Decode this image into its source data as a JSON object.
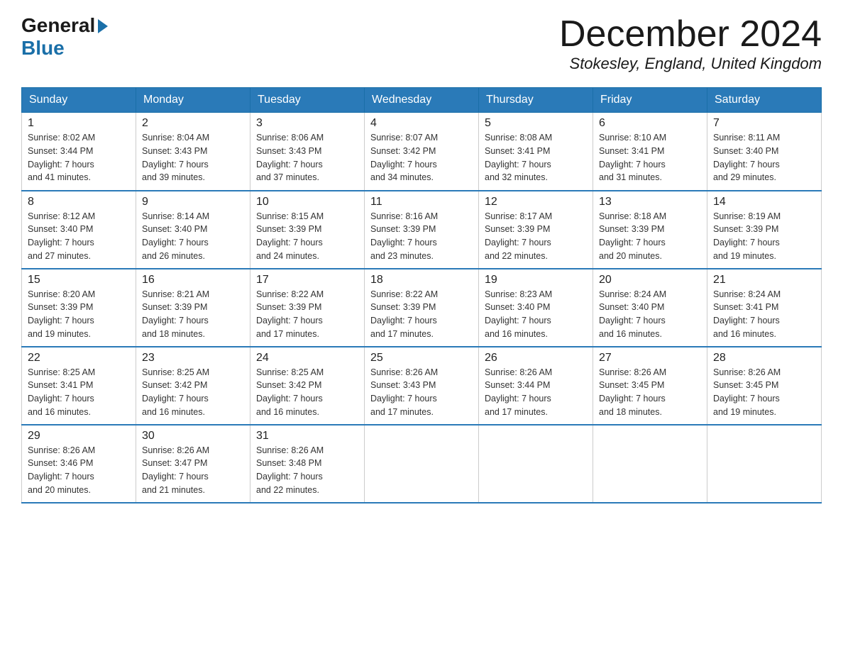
{
  "header": {
    "logo_general": "General",
    "logo_blue": "Blue",
    "month_title": "December 2024",
    "location": "Stokesley, England, United Kingdom"
  },
  "days_of_week": [
    "Sunday",
    "Monday",
    "Tuesday",
    "Wednesday",
    "Thursday",
    "Friday",
    "Saturday"
  ],
  "weeks": [
    [
      {
        "day": "1",
        "sunrise": "8:02 AM",
        "sunset": "3:44 PM",
        "daylight": "7 hours and 41 minutes."
      },
      {
        "day": "2",
        "sunrise": "8:04 AM",
        "sunset": "3:43 PM",
        "daylight": "7 hours and 39 minutes."
      },
      {
        "day": "3",
        "sunrise": "8:06 AM",
        "sunset": "3:43 PM",
        "daylight": "7 hours and 37 minutes."
      },
      {
        "day": "4",
        "sunrise": "8:07 AM",
        "sunset": "3:42 PM",
        "daylight": "7 hours and 34 minutes."
      },
      {
        "day": "5",
        "sunrise": "8:08 AM",
        "sunset": "3:41 PM",
        "daylight": "7 hours and 32 minutes."
      },
      {
        "day": "6",
        "sunrise": "8:10 AM",
        "sunset": "3:41 PM",
        "daylight": "7 hours and 31 minutes."
      },
      {
        "day": "7",
        "sunrise": "8:11 AM",
        "sunset": "3:40 PM",
        "daylight": "7 hours and 29 minutes."
      }
    ],
    [
      {
        "day": "8",
        "sunrise": "8:12 AM",
        "sunset": "3:40 PM",
        "daylight": "7 hours and 27 minutes."
      },
      {
        "day": "9",
        "sunrise": "8:14 AM",
        "sunset": "3:40 PM",
        "daylight": "7 hours and 26 minutes."
      },
      {
        "day": "10",
        "sunrise": "8:15 AM",
        "sunset": "3:39 PM",
        "daylight": "7 hours and 24 minutes."
      },
      {
        "day": "11",
        "sunrise": "8:16 AM",
        "sunset": "3:39 PM",
        "daylight": "7 hours and 23 minutes."
      },
      {
        "day": "12",
        "sunrise": "8:17 AM",
        "sunset": "3:39 PM",
        "daylight": "7 hours and 22 minutes."
      },
      {
        "day": "13",
        "sunrise": "8:18 AM",
        "sunset": "3:39 PM",
        "daylight": "7 hours and 20 minutes."
      },
      {
        "day": "14",
        "sunrise": "8:19 AM",
        "sunset": "3:39 PM",
        "daylight": "7 hours and 19 minutes."
      }
    ],
    [
      {
        "day": "15",
        "sunrise": "8:20 AM",
        "sunset": "3:39 PM",
        "daylight": "7 hours and 19 minutes."
      },
      {
        "day": "16",
        "sunrise": "8:21 AM",
        "sunset": "3:39 PM",
        "daylight": "7 hours and 18 minutes."
      },
      {
        "day": "17",
        "sunrise": "8:22 AM",
        "sunset": "3:39 PM",
        "daylight": "7 hours and 17 minutes."
      },
      {
        "day": "18",
        "sunrise": "8:22 AM",
        "sunset": "3:39 PM",
        "daylight": "7 hours and 17 minutes."
      },
      {
        "day": "19",
        "sunrise": "8:23 AM",
        "sunset": "3:40 PM",
        "daylight": "7 hours and 16 minutes."
      },
      {
        "day": "20",
        "sunrise": "8:24 AM",
        "sunset": "3:40 PM",
        "daylight": "7 hours and 16 minutes."
      },
      {
        "day": "21",
        "sunrise": "8:24 AM",
        "sunset": "3:41 PM",
        "daylight": "7 hours and 16 minutes."
      }
    ],
    [
      {
        "day": "22",
        "sunrise": "8:25 AM",
        "sunset": "3:41 PM",
        "daylight": "7 hours and 16 minutes."
      },
      {
        "day": "23",
        "sunrise": "8:25 AM",
        "sunset": "3:42 PM",
        "daylight": "7 hours and 16 minutes."
      },
      {
        "day": "24",
        "sunrise": "8:25 AM",
        "sunset": "3:42 PM",
        "daylight": "7 hours and 16 minutes."
      },
      {
        "day": "25",
        "sunrise": "8:26 AM",
        "sunset": "3:43 PM",
        "daylight": "7 hours and 17 minutes."
      },
      {
        "day": "26",
        "sunrise": "8:26 AM",
        "sunset": "3:44 PM",
        "daylight": "7 hours and 17 minutes."
      },
      {
        "day": "27",
        "sunrise": "8:26 AM",
        "sunset": "3:45 PM",
        "daylight": "7 hours and 18 minutes."
      },
      {
        "day": "28",
        "sunrise": "8:26 AM",
        "sunset": "3:45 PM",
        "daylight": "7 hours and 19 minutes."
      }
    ],
    [
      {
        "day": "29",
        "sunrise": "8:26 AM",
        "sunset": "3:46 PM",
        "daylight": "7 hours and 20 minutes."
      },
      {
        "day": "30",
        "sunrise": "8:26 AM",
        "sunset": "3:47 PM",
        "daylight": "7 hours and 21 minutes."
      },
      {
        "day": "31",
        "sunrise": "8:26 AM",
        "sunset": "3:48 PM",
        "daylight": "7 hours and 22 minutes."
      },
      {
        "day": "",
        "sunrise": "",
        "sunset": "",
        "daylight": ""
      },
      {
        "day": "",
        "sunrise": "",
        "sunset": "",
        "daylight": ""
      },
      {
        "day": "",
        "sunrise": "",
        "sunset": "",
        "daylight": ""
      },
      {
        "day": "",
        "sunrise": "",
        "sunset": "",
        "daylight": ""
      }
    ]
  ],
  "labels": {
    "sunrise_prefix": "Sunrise: ",
    "sunset_prefix": "Sunset: ",
    "daylight_prefix": "Daylight: "
  }
}
